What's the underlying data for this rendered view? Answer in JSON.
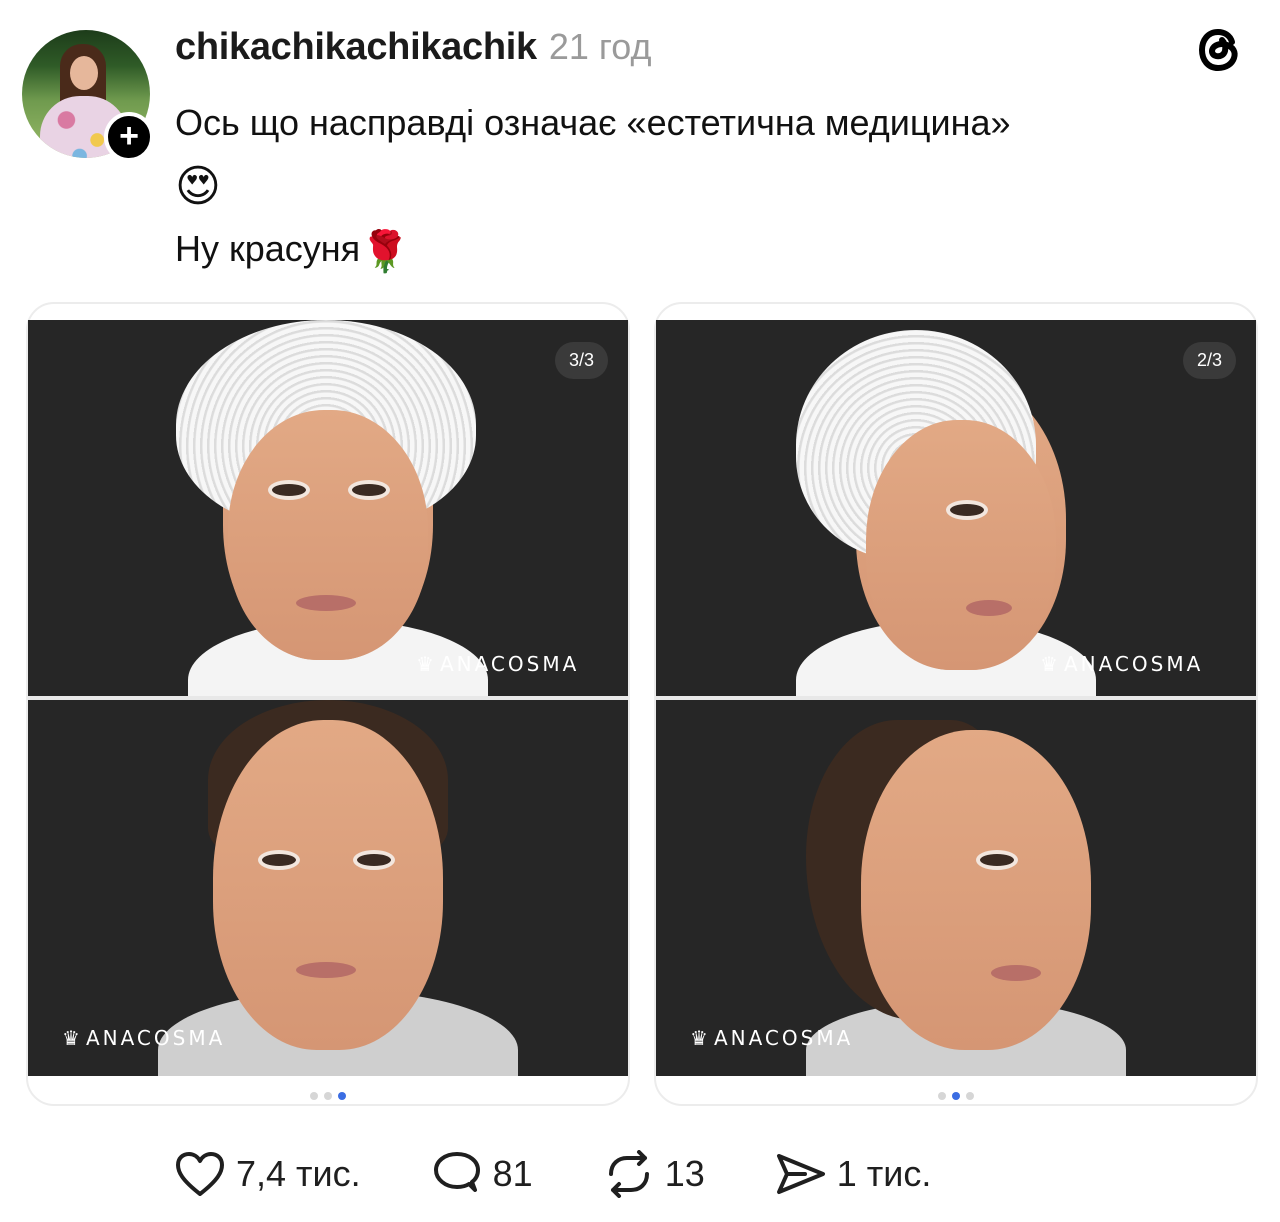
{
  "post": {
    "username": "chikachikachikachik",
    "time": "21 год",
    "text_line1": "Ось що насправді означає «естетична медицина»",
    "emoji_line": "😍",
    "text_line3": "Ну красуня",
    "rose_emoji": "🌹"
  },
  "follow_button": {
    "icon": "plus-icon",
    "label": "+"
  },
  "header_logo": "threads-logo-icon",
  "carousels": [
    {
      "counter": "3/3",
      "brand_top": "ANACOSMA",
      "brand_bottom": "ANACOSMA",
      "active_dot": 3
    },
    {
      "counter": "2/3",
      "brand_top": "ANACOSMA",
      "brand_bottom": "ANACOSMA",
      "active_dot": 2
    }
  ],
  "actions": {
    "likes": "7,4 тис.",
    "comments": "81",
    "reposts": "13",
    "shares": "1 тис."
  },
  "colors": {
    "accent_dot": "#3b6de3",
    "muted": "#9a9a9a",
    "photo_bg": "#262626"
  }
}
